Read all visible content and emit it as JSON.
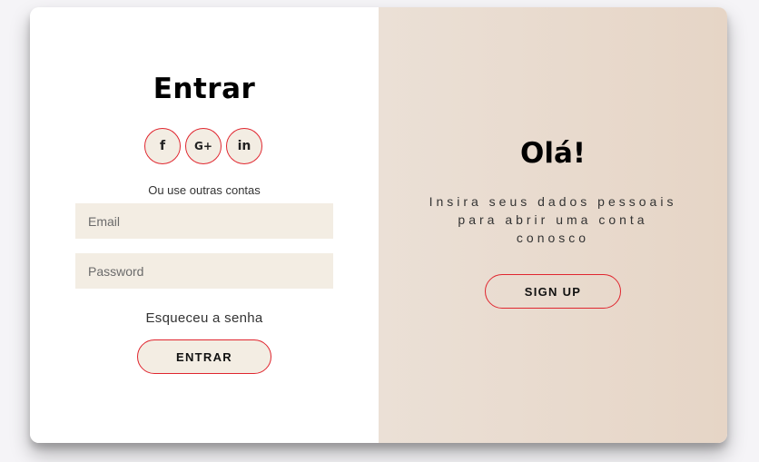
{
  "login": {
    "title": "Entrar",
    "social": [
      {
        "icon": "facebook-icon",
        "glyph": "f"
      },
      {
        "icon": "google-plus-icon",
        "glyph": "G+"
      },
      {
        "icon": "linkedin-icon",
        "glyph": "in"
      }
    ],
    "alt_text": "Ou use outras contas",
    "email_placeholder": "Email",
    "password_placeholder": "Password",
    "forgot_link": "Esqueceu a senha",
    "submit_label": "ENTRAR"
  },
  "signup_panel": {
    "title": "Olá!",
    "subtitle": "Insira seus dados pessoais para abrir uma conta conosco",
    "button_label": "SIGN UP"
  },
  "colors": {
    "accent_border": "#e0262f",
    "input_bg": "#f3ede3",
    "panel_bg": "#e8dacd"
  }
}
